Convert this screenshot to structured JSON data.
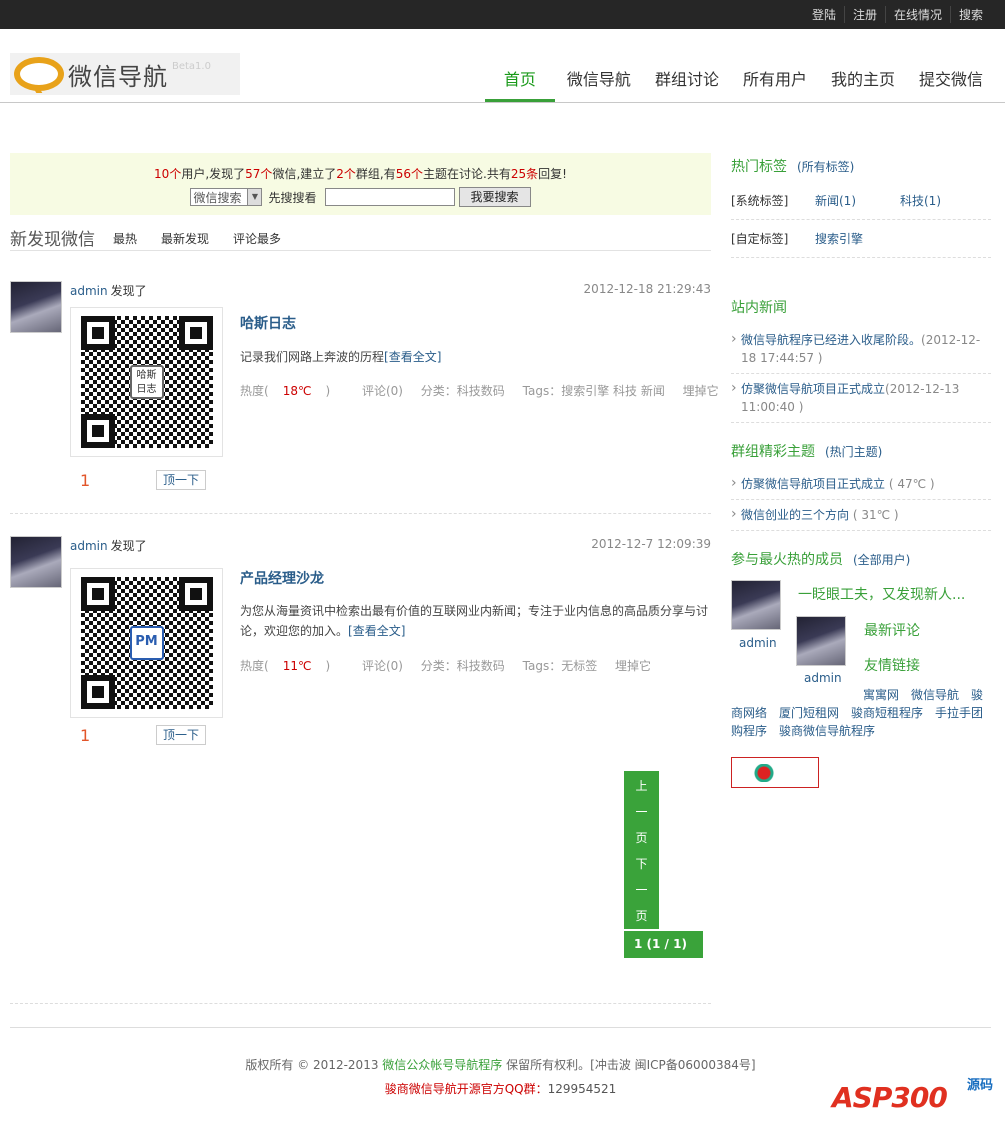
{
  "topbar": {
    "links": [
      "登陆",
      "注册",
      "在线情况",
      "搜索"
    ]
  },
  "header": {
    "logo_text": "微信导航",
    "logo_beta": "Beta1.0",
    "nav": [
      "首页",
      "微信导航",
      "群组讨论",
      "所有用户",
      "我的主页",
      "提交微信"
    ]
  },
  "stats": {
    "users": "10个",
    "t1": "用户,发现了",
    "weixins": "57个",
    "t2": "微信,建立了",
    "groups": "2个",
    "t3": "群组,有",
    "topics": "56个",
    "t4": "主题在讨论.共有",
    "replies": "25条",
    "t5": "回复!"
  },
  "search": {
    "select_value": "微信搜索",
    "label": "先搜搜看",
    "button": "我要搜索"
  },
  "tabs": {
    "title": "新发现微信",
    "items": [
      "最热",
      "最新发现",
      "评论最多"
    ]
  },
  "posts": [
    {
      "user": "admin",
      "action": "发现了",
      "time": "2012-12-18 21:29:43",
      "qr_center": "哈斯\n日志",
      "title": "哈斯日志",
      "desc": "记录我们网路上奔波的历程",
      "more": "[查看全文]",
      "heat_label": "热度(",
      "heat": "18℃",
      "heat_end": ")",
      "comments": "评论(0)",
      "category": "分类：科技数码",
      "tags": "Tags：搜索引擎 科技 新闻",
      "bury": "埋掉它",
      "count": "1",
      "top": "顶一下"
    },
    {
      "user": "admin",
      "action": "发现了",
      "time": "2012-12-7 12:09:39",
      "qr_center": "PM",
      "title": "产品经理沙龙",
      "desc": "为您从海量资讯中检索出最有价值的互联网业内新闻；专注于业内信息的高品质分享与讨论，欢迎您的加入。",
      "more": "[查看全文]",
      "heat_label": "热度(",
      "heat": "11℃",
      "heat_end": ")",
      "comments": "评论(0)",
      "category": "分类：科技数码",
      "tags": "Tags：无标签",
      "bury": "埋掉它",
      "count": "1",
      "top": "顶一下"
    }
  ],
  "pager": {
    "prev": [
      "上",
      "一",
      "页"
    ],
    "next": [
      "下",
      "一",
      "页"
    ],
    "status": "1 (1 / 1)"
  },
  "sidebar": {
    "hot_tags": {
      "title": "热门标签",
      "all": "(所有标签)",
      "system_label": "[系统标签]",
      "system_tags": [
        "新闻(1)",
        "科技(1)"
      ],
      "custom_label": "[自定标签]",
      "custom_tags": [
        "搜索引擎"
      ]
    },
    "news": {
      "title": "站内新闻",
      "items": [
        {
          "text": "微信导航程序已经进入收尾阶段。",
          "date": "(2012-12-18 17:44:57 )"
        },
        {
          "text": "仿聚微信导航项目正式成立",
          "date": "(2012-12-13 11:00:40 )"
        }
      ]
    },
    "group": {
      "title": "群组精彩主题",
      "hot": "(热门主题)",
      "items": [
        {
          "text": "仿聚微信导航项目正式成立",
          "heat": "( 47℃ )"
        },
        {
          "text": "微信创业的三个方向",
          "heat": "( 31℃ )"
        }
      ]
    },
    "members": {
      "title": "参与最火热的成员",
      "all": "(全部用户)",
      "users": [
        "admin",
        "admin"
      ],
      "tagline": "一眨眼工夫，又发现新人...",
      "latest_comments": "最新评论",
      "friend_links_title": "友情链接"
    },
    "friend_links": [
      "寓寓网",
      "微信导航",
      "骏商网络",
      "厦门短租网",
      "骏商短租程序",
      "手拉手团购程序",
      "骏商微信导航程序"
    ]
  },
  "footer": {
    "copyright_pre": "版权所有 © 2012-2013",
    "site": "微信公众帐号导航程序",
    "copyright_post": "保留所有权利。[冲击波 闽ICP备06000384号]",
    "qq_label": "骏商微信导航开源官方QQ群：",
    "qq": "129954521"
  },
  "watermark": {
    "brand": "ASP300",
    "suffix": "源码"
  },
  "colors": {
    "accent": "#39a039",
    "topbar": "#262626",
    "red": "#cc0000",
    "link": "#2a5d8a"
  }
}
